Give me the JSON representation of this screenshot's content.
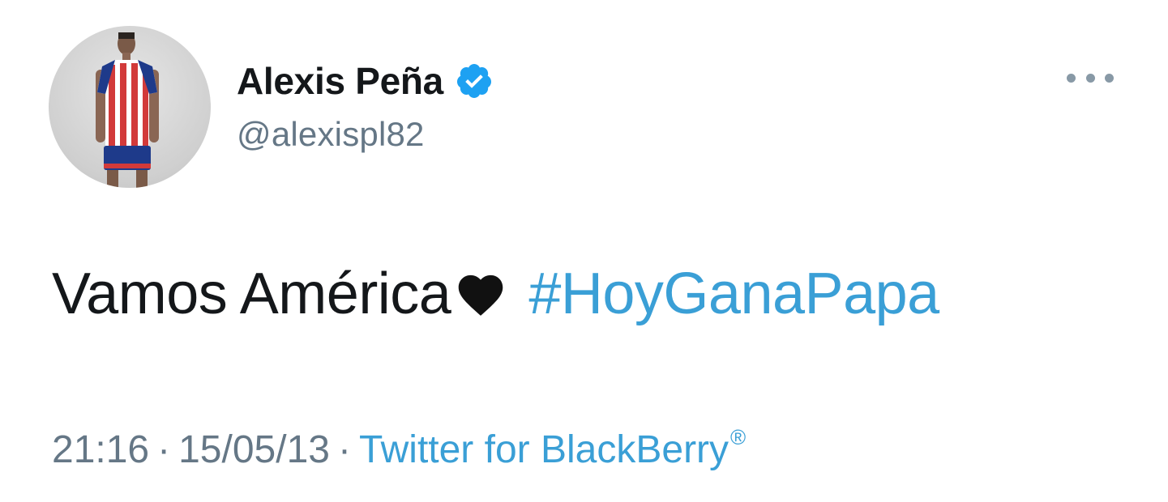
{
  "tweet": {
    "author": {
      "display_name": "Alexis Peña",
      "handle": "@alexispl82",
      "verified": true
    },
    "body": {
      "text": "Vamos América",
      "emoji": "black-heart",
      "hashtag": "#HoyGanaPapa"
    },
    "meta": {
      "time": "21:16",
      "separator": "·",
      "date": "15/05/13",
      "source": "Twitter for BlackBerry",
      "registered_mark": "®"
    }
  },
  "colors": {
    "link": "#3a9fd6",
    "verified_badge": "#1da1f2",
    "text_primary": "#14171a",
    "text_secondary": "#657786"
  },
  "icons": {
    "more": "more-options-icon",
    "verified": "verified-badge-icon",
    "emoji": "black-heart-icon"
  }
}
